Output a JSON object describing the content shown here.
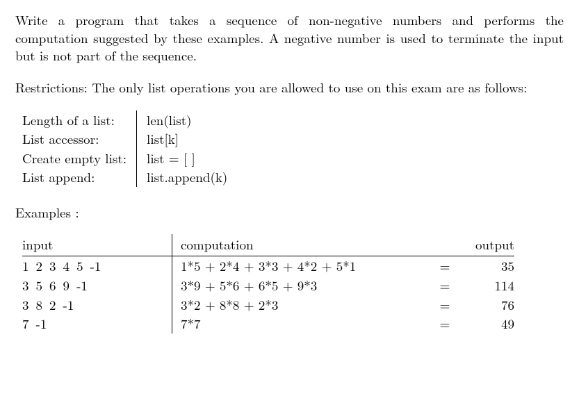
{
  "intro": "Write a program that takes a sequence of non-negative numbers and performs the computation suggested by these examples. A negative number is used to terminate the input but is not part of the sequence.",
  "restrictions_label": "Restrictions: The only list operations you are allowed to use on this exam are as follows:",
  "operations": [
    {
      "desc": "Length of a list:",
      "code": "len(list)"
    },
    {
      "desc": "List accessor:",
      "code": "list[k]"
    },
    {
      "desc": "Create empty list:",
      "code": "list = [ ]"
    },
    {
      "desc": "List append:",
      "code": "list.append(k)"
    }
  ],
  "examples_label": "Examples :",
  "headers": {
    "input": "input",
    "computation": "computation",
    "output": "output"
  },
  "eq": "=",
  "examples": [
    {
      "input": [
        "1",
        "2",
        "3",
        "4",
        "5",
        "-1"
      ],
      "computation": "1*5 + 2*4 + 3*3 + 4*2 + 5*1",
      "output": "35"
    },
    {
      "input": [
        "3",
        "5",
        "6",
        "9",
        "-1"
      ],
      "computation": "3*9 + 5*6 + 6*5 + 9*3",
      "output": "114"
    },
    {
      "input": [
        "3",
        "8",
        "2",
        "-1"
      ],
      "computation": "3*2 + 8*8 + 2*3",
      "output": "76"
    },
    {
      "input": [
        "7",
        "-1"
      ],
      "computation": "7*7",
      "output": "49"
    }
  ]
}
